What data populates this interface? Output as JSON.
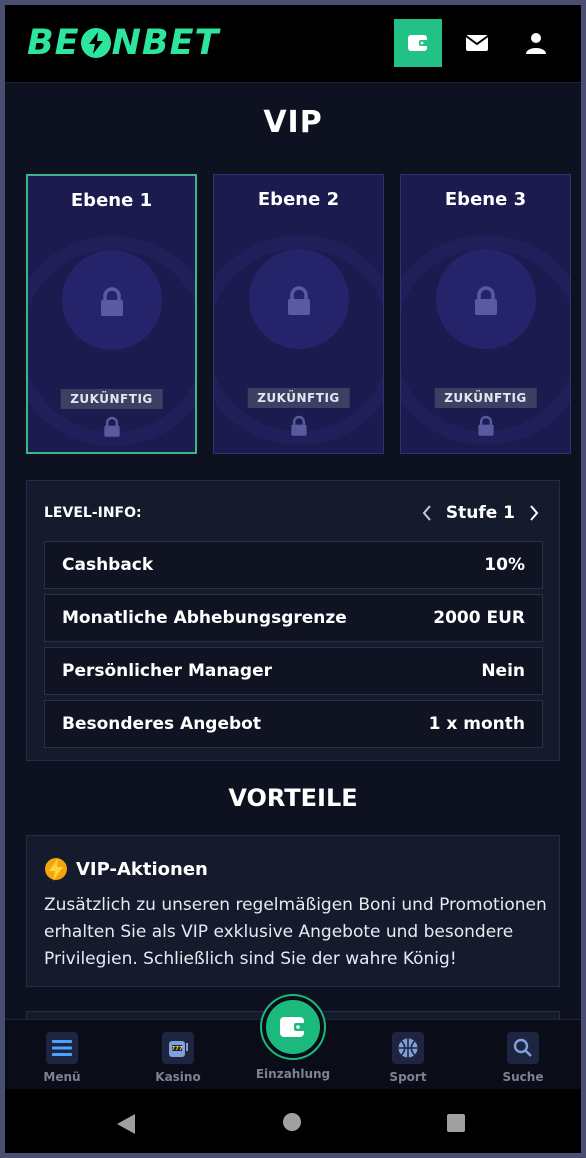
{
  "header": {
    "logo": "BEONBET",
    "accent": "#2ee59d"
  },
  "vip": {
    "title": "VIP",
    "levels": [
      {
        "name": "Ebene 1",
        "badge": "ZUKÜNFTIG",
        "locked": true
      },
      {
        "name": "Ebene 2",
        "badge": "ZUKÜNFTIG",
        "locked": true
      },
      {
        "name": "Ebene 3",
        "badge": "ZUKÜNFTIG",
        "locked": true
      }
    ]
  },
  "level_info": {
    "label": "LEVEL-INFO:",
    "stufe": "Stufe 1",
    "rows": [
      {
        "key": "Cashback",
        "value": "10%"
      },
      {
        "key": "Monatliche Abhebungsgrenze",
        "value": "2000 EUR"
      },
      {
        "key": "Persönlicher Manager",
        "value": "Nein"
      },
      {
        "key": "Besonderes Angebot",
        "value": "1 x month"
      }
    ]
  },
  "vorteile": {
    "title": "VORTEILE",
    "items": [
      {
        "icon": "lightning-icon",
        "title": "VIP-Aktionen",
        "text": "Zusätzlich zu unseren regelmäßigen Boni und Promotionen erhalten Sie als VIP exklusive Angebote und besondere Privilegien. Schließlich sind Sie der wahre König!"
      }
    ]
  },
  "bottom_nav": {
    "items": [
      {
        "label": "Menü",
        "icon": "menu-icon"
      },
      {
        "label": "Kasino",
        "icon": "slot-machine-icon"
      },
      {
        "label": "Einzahlung",
        "icon": "wallet-icon"
      },
      {
        "label": "Sport",
        "icon": "basketball-icon"
      },
      {
        "label": "Suche",
        "icon": "search-icon"
      }
    ]
  }
}
